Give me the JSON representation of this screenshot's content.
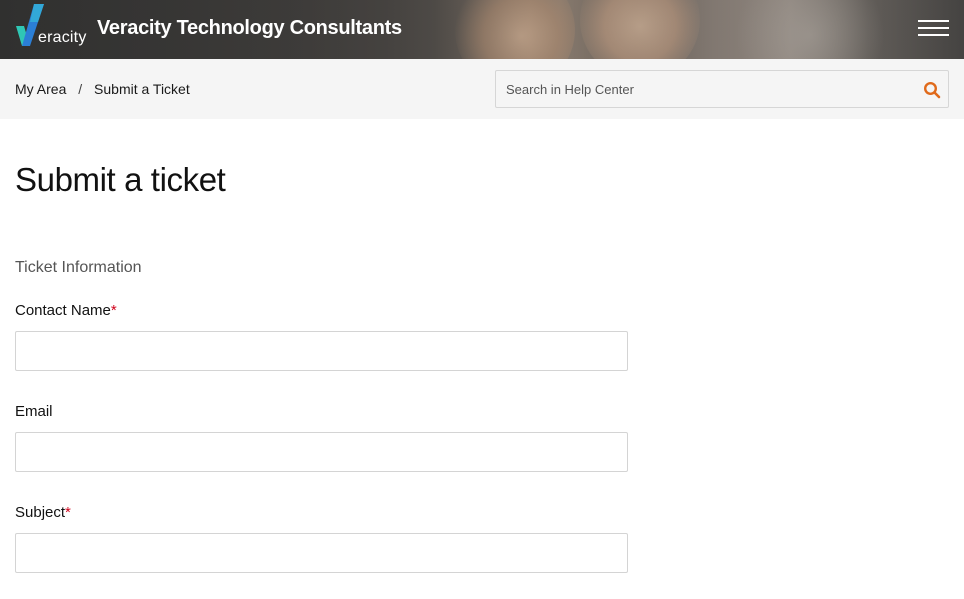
{
  "header": {
    "logo_text": "eracity",
    "site_title": "Veracity Technology Consultants",
    "logo_colors": {
      "teal": "#2fc7b5",
      "blue": "#2b7fd6"
    }
  },
  "breadcrumb": {
    "items": [
      {
        "label": "My Area"
      },
      {
        "label": "Submit a Ticket"
      }
    ],
    "separator": "/"
  },
  "search": {
    "placeholder": "Search in Help Center",
    "value": "",
    "icon_color": "#e06a1b"
  },
  "main": {
    "page_title": "Submit a ticket",
    "section_title": "Ticket Information",
    "fields": [
      {
        "label": "Contact Name",
        "required_mark": "*",
        "value": ""
      },
      {
        "label": "Email",
        "required_mark": "",
        "value": ""
      },
      {
        "label": "Subject",
        "required_mark": "*",
        "value": ""
      }
    ]
  }
}
